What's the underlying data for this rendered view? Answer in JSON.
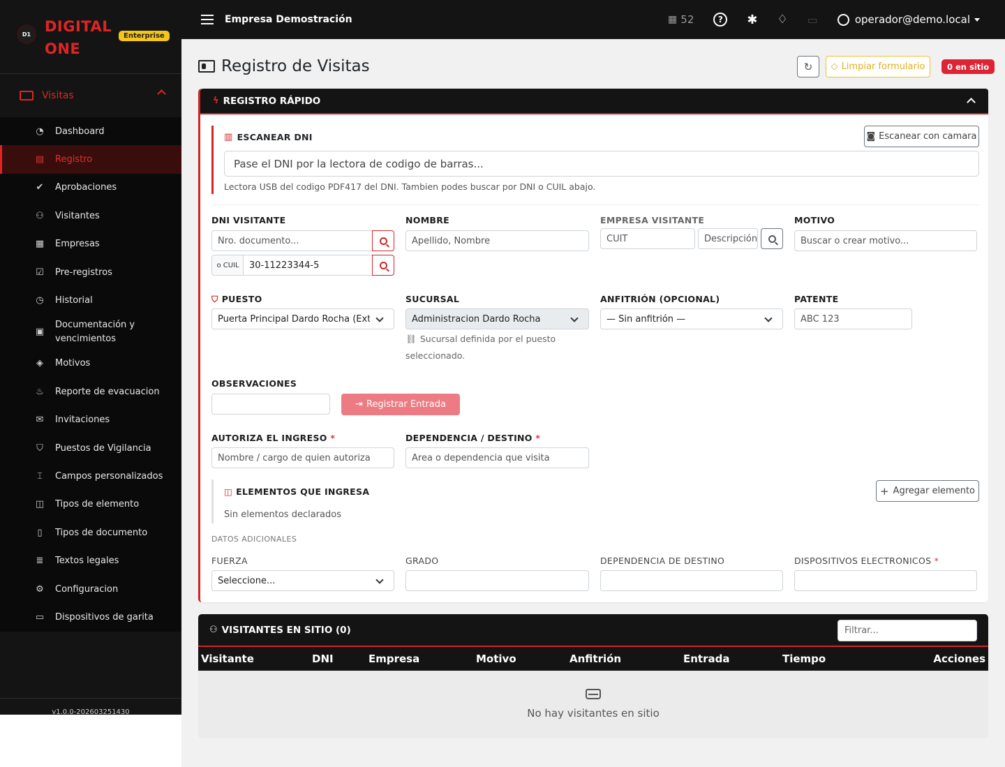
{
  "brand": {
    "logo_text": "D1",
    "name_line1": "DIGITAL",
    "name_line2": "ONE",
    "badge": "Enterprise",
    "accent_color": "#e02424"
  },
  "sidebar": {
    "group_label": "Visitas",
    "items": [
      {
        "label": "Dashboard",
        "icon": "gauge-icon"
      },
      {
        "label": "Registro",
        "icon": "clipboard-icon",
        "active": true
      },
      {
        "label": "Aprobaciones",
        "icon": "check-double-icon"
      },
      {
        "label": "Visitantes",
        "icon": "people-icon"
      },
      {
        "label": "Empresas",
        "icon": "building-icon"
      },
      {
        "label": "Pre-registros",
        "icon": "calendar-check-icon"
      },
      {
        "label": "Historial",
        "icon": "clock-icon"
      },
      {
        "label": "Documentación y vencimientos",
        "icon": "clipboard-check-icon"
      },
      {
        "label": "Motivos",
        "icon": "tags-icon"
      },
      {
        "label": "Reporte de evacuacion",
        "icon": "fire-icon"
      },
      {
        "label": "Invitaciones",
        "icon": "envelope-icon"
      },
      {
        "label": "Puestos de Vigilancia",
        "icon": "shield-icon"
      },
      {
        "label": "Campos personalizados",
        "icon": "input-cursor-icon"
      },
      {
        "label": "Tipos de elemento",
        "icon": "box-icon"
      },
      {
        "label": "Tipos de documento",
        "icon": "file-icon"
      },
      {
        "label": "Textos legales",
        "icon": "file-text-icon"
      },
      {
        "label": "Configuracion",
        "icon": "gear-icon"
      },
      {
        "label": "Dispositivos de garita",
        "icon": "tablet-icon"
      }
    ],
    "version": "v1.0.0-202603251430"
  },
  "topbar": {
    "company": "Empresa Demostración",
    "building_count": "52",
    "help": "?",
    "user": "operador@demo.local"
  },
  "page": {
    "title": "Registro de Visitas",
    "clear_button": "Limpiar formulario",
    "on_site_badge": "0 en sitio"
  },
  "quick": {
    "header": "REGISTRO RÁPIDO",
    "scan_title": "ESCANEAR DNI",
    "camera_button": "Escanear con camara",
    "scan_placeholder": "Pase el DNI por la lectora de codigo de barras...",
    "scan_help": "Lectora USB del codigo PDF417 del DNI. Tambien podes buscar por DNI o CUIL abajo.",
    "dni_label": "DNI VISITANTE",
    "dni_placeholder": "Nro. documento...",
    "cuil_prefix": "o CUIL",
    "cuil_value": "30-11223344-5",
    "nombre_label": "NOMBRE",
    "nombre_placeholder": "Apellido, Nombre",
    "empresa_label": "EMPRESA VISITANTE",
    "cuit_placeholder": "CUIT",
    "descripcion_placeholder": "Descripción",
    "motivo_label": "MOTIVO",
    "motivo_placeholder": "Buscar o crear motivo...",
    "puesto_label": "PUESTO",
    "puesto_value": "Puerta Principal Dardo Rocha (Exterior)",
    "sucursal_label": "SUCURSAL",
    "sucursal_value": "Administracion Dardo Rocha",
    "sucursal_help": "Sucursal definida por el puesto seleccionado.",
    "anfitrion_label": "ANFITRIÓN (OPCIONAL)",
    "anfitrion_value": "— Sin anfitrión —",
    "patente_label": "PATENTE",
    "patente_placeholder": "ABC 123",
    "obs_label": "OBSERVACIONES",
    "register_button": "Registrar Entrada",
    "autoriza_label": "AUTORIZA EL INGRESO",
    "autoriza_placeholder": "Nombre / cargo de quien autoriza",
    "dependencia_label": "DEPENDENCIA / DESTINO",
    "dependencia_placeholder": "Area o dependencia que visita",
    "elements_title": "ELEMENTOS QUE INGRESA",
    "add_element_button": "Agregar elemento",
    "no_elements": "Sin elementos declarados",
    "extra_title": "DATOS ADICIONALES",
    "fuerza_label": "FUERZA",
    "fuerza_value": "Seleccione...",
    "grado_label": "GRADO",
    "dep_destino_label": "DEPENDENCIA DE DESTINO",
    "dispositivos_label": "DISPOSITIVOS ELECTRONICOS",
    "required_mark": "*"
  },
  "visitors": {
    "header": "VISITANTES EN SITIO (0)",
    "filter_placeholder": "Filtrar...",
    "columns": [
      "Visitante",
      "DNI",
      "Empresa",
      "Motivo",
      "Anfitrión",
      "Entrada",
      "Tiempo",
      "Acciones"
    ],
    "empty": "No hay visitantes en sitio"
  }
}
